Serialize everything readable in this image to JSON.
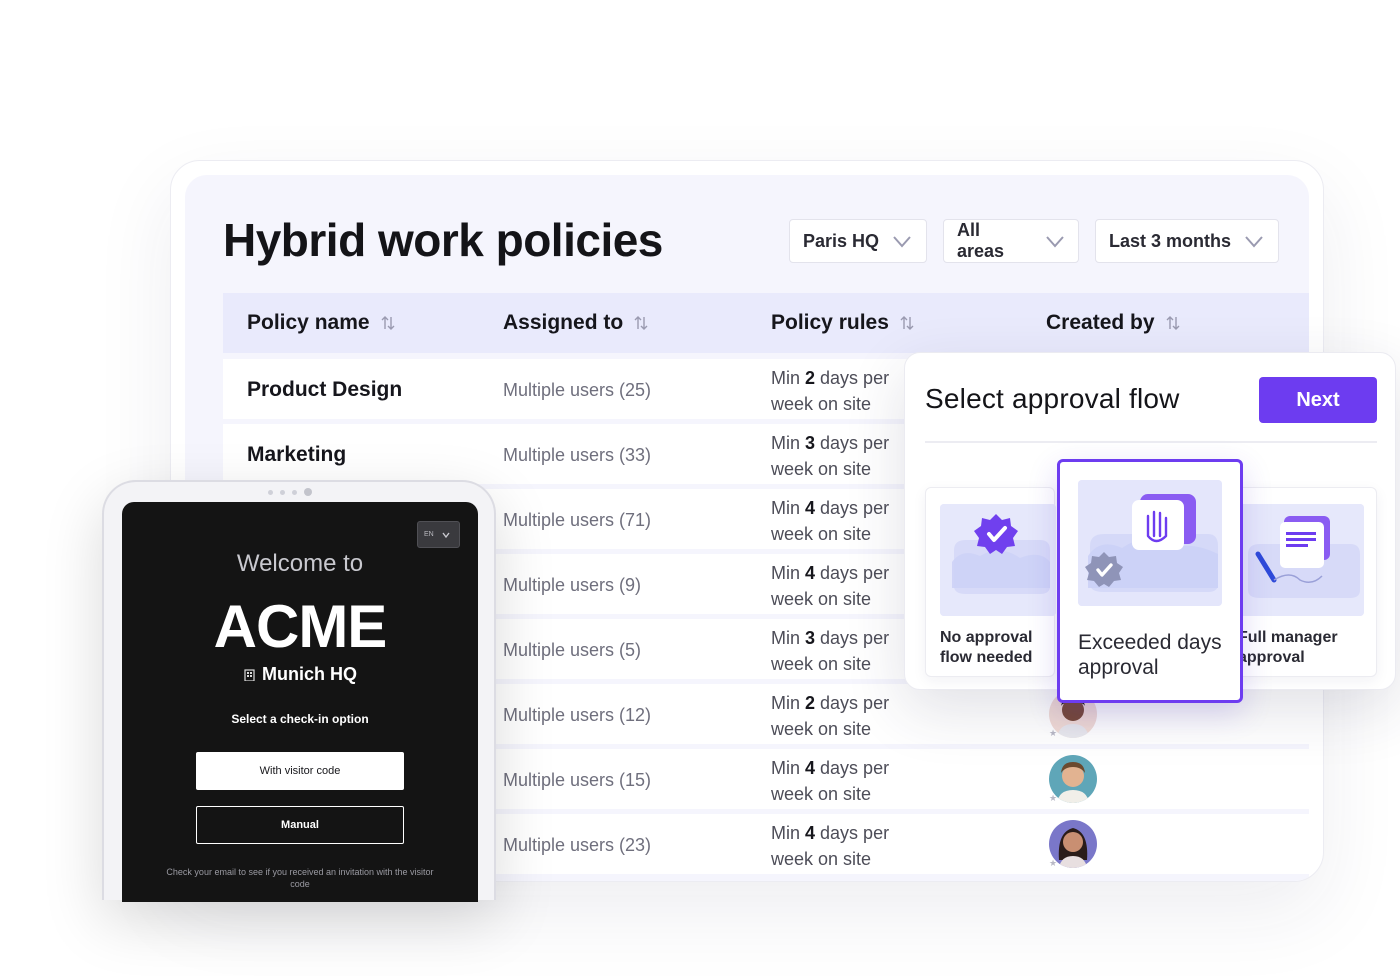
{
  "dashboard": {
    "title": "Hybrid work policies",
    "filters": [
      {
        "label": "Paris HQ"
      },
      {
        "label": "All areas"
      },
      {
        "label": "Last 3 months"
      }
    ],
    "columns": [
      "Policy name",
      "Assigned to",
      "Policy rules",
      "Created by"
    ],
    "rows": [
      {
        "name": "Product Design",
        "assigned": "Multiple users (25)",
        "rule_prefix": "Min ",
        "rule_days": "2",
        "rule_suffix": " days per",
        "rule_line2": "week on site"
      },
      {
        "name": "Marketing",
        "assigned": "Multiple users (33)",
        "rule_prefix": "Min ",
        "rule_days": "3",
        "rule_suffix": " days per",
        "rule_line2": "week on site"
      },
      {
        "name": "",
        "assigned": "Multiple users (71)",
        "rule_prefix": "Min ",
        "rule_days": "4",
        "rule_suffix": " days per",
        "rule_line2": "week on site"
      },
      {
        "name": "",
        "assigned": "Multiple users (9)",
        "rule_prefix": "Min ",
        "rule_days": "4",
        "rule_suffix": " days per",
        "rule_line2": "week on site"
      },
      {
        "name": "",
        "assigned": "Multiple users (5)",
        "rule_prefix": "Min ",
        "rule_days": "3",
        "rule_suffix": " days per",
        "rule_line2": "week on site"
      },
      {
        "name": "",
        "assigned": "Multiple users (12)",
        "rule_prefix": "Min ",
        "rule_days": "2",
        "rule_suffix": " days per",
        "rule_line2": "week on site",
        "avatar": "avatar-1"
      },
      {
        "name": "",
        "assigned": "Multiple users (15)",
        "rule_prefix": "Min ",
        "rule_days": "4",
        "rule_suffix": " days per",
        "rule_line2": "week on site",
        "avatar": "avatar-2"
      },
      {
        "name": "",
        "assigned": "Multiple users (23)",
        "rule_prefix": "Min ",
        "rule_days": "4",
        "rule_suffix": " days per",
        "rule_line2": "week on site",
        "avatar": "avatar-3"
      }
    ]
  },
  "tablet": {
    "language": "EN",
    "welcome": "Welcome to",
    "brand": "ACME",
    "site": "Munich HQ",
    "select_prompt": "Select a check-in option",
    "visitor_button": "With visitor code",
    "manual_button": "Manual",
    "hint": "Check your email to see if you received an invitation with the visitor code"
  },
  "approval": {
    "title": "Select approval flow",
    "next": "Next",
    "options": [
      {
        "label": "No approval flow needed",
        "icon": "verified-badge-icon"
      },
      {
        "label": "Exceeded days approval",
        "icon": "hand-stop-icon",
        "selected": true
      },
      {
        "label": "Full manager approval",
        "icon": "signature-document-icon"
      }
    ]
  },
  "colors": {
    "accent": "#6d3cf0",
    "table_header_bg": "#e9eafc",
    "page_bg": "#f5f5fd",
    "tablet_screen": "#141414"
  }
}
